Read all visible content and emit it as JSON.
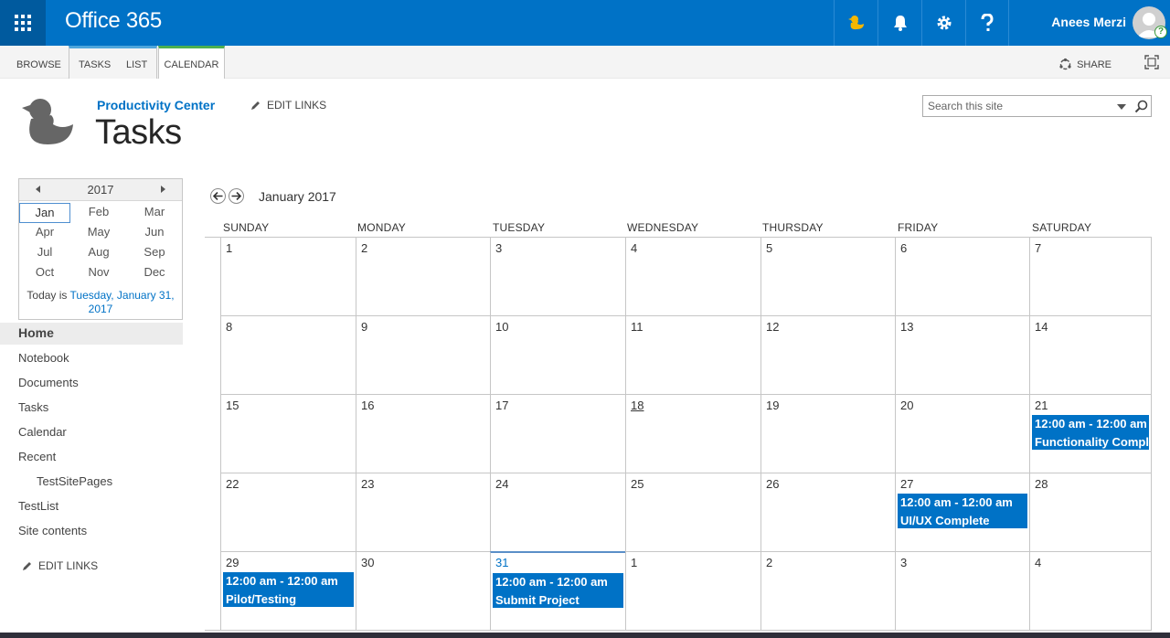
{
  "suite": {
    "brand": "Office 365",
    "user_name": "Anees Merzi"
  },
  "ribbon": {
    "tabs": [
      "BROWSE",
      "TASKS",
      "LIST",
      "CALENDAR"
    ],
    "share_label": "SHARE"
  },
  "header": {
    "site_name": "Productivity Center",
    "edit_links": "EDIT LINKS",
    "page_title": "Tasks",
    "search_placeholder": "Search this site"
  },
  "datepicker": {
    "year": "2017",
    "months": [
      "Jan",
      "Feb",
      "Mar",
      "Apr",
      "May",
      "Jun",
      "Jul",
      "Aug",
      "Sep",
      "Oct",
      "Nov",
      "Dec"
    ],
    "selected_month": "Jan",
    "today_prefix": "Today is ",
    "today_link_line1": "Tuesday, January 31,",
    "today_link_line2": "2017"
  },
  "nav": {
    "items": [
      "Home",
      "Notebook",
      "Documents",
      "Tasks",
      "Calendar",
      "Recent",
      "TestSitePages",
      "TestList",
      "Site contents"
    ],
    "edit_links": "EDIT LINKS"
  },
  "calendar": {
    "month_label": "January 2017",
    "day_headers": [
      "SUNDAY",
      "MONDAY",
      "TUESDAY",
      "WEDNESDAY",
      "THURSDAY",
      "FRIDAY",
      "SATURDAY"
    ],
    "weeks": [
      [
        "1",
        "2",
        "3",
        "4",
        "5",
        "6",
        "7"
      ],
      [
        "8",
        "9",
        "10",
        "11",
        "12",
        "13",
        "14"
      ],
      [
        "15",
        "16",
        "17",
        "18",
        "19",
        "20",
        "21"
      ],
      [
        "22",
        "23",
        "24",
        "25",
        "26",
        "27",
        "28"
      ],
      [
        "29",
        "30",
        "31",
        "1",
        "2",
        "3",
        "4"
      ]
    ],
    "events": [
      {
        "week": 2,
        "day": 6,
        "time": "12:00 am - 12:00 am",
        "title": "Functionality Complete"
      },
      {
        "week": 3,
        "day": 5,
        "time": "12:00 am - 12:00 am",
        "title": "UI/UX Complete"
      },
      {
        "week": 4,
        "day": 0,
        "time": "12:00 am - 12:00 am",
        "title": "Pilot/Testing"
      },
      {
        "week": 4,
        "day": 2,
        "time": "12:00 am - 12:00 am",
        "title": "Submit Project"
      }
    ],
    "accent_color": "#0072c6"
  }
}
